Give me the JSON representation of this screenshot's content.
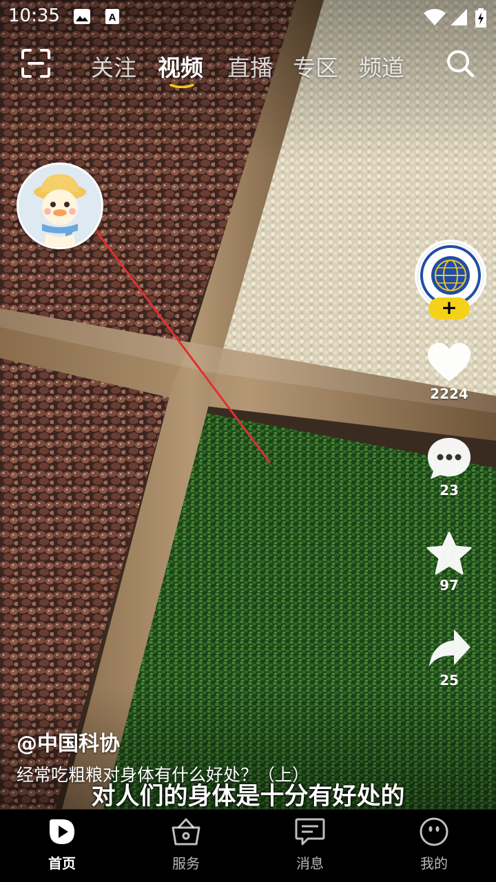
{
  "status_bar": {
    "time": "10:35",
    "left_icons": [
      "image-notification-icon",
      "font-notification-icon"
    ],
    "right_icons": [
      "wifi-icon",
      "signal-icon",
      "battery-charging-icon"
    ]
  },
  "top_nav": {
    "tabs": [
      {
        "label": "关注",
        "active": false
      },
      {
        "label": "视频",
        "active": true
      },
      {
        "label": "直播",
        "active": false
      },
      {
        "label": "专区",
        "active": false
      },
      {
        "label": "频道",
        "active": false
      }
    ],
    "accent_color": "#f5c518"
  },
  "right_rail": {
    "follow_label": "+",
    "like_count": "2224",
    "comment_count": "23",
    "favorite_count": "97",
    "share_count": "25"
  },
  "video": {
    "author": "@中国科协",
    "title": "经常吃粗粮对身体有什么好处？（上）",
    "subtitle": "对人们的身体是十分有好处的"
  },
  "bottom_nav": {
    "items": [
      {
        "label": "首页",
        "icon": "home-play-icon",
        "active": true
      },
      {
        "label": "服务",
        "icon": "service-basket-icon",
        "active": false
      },
      {
        "label": "消息",
        "icon": "message-icon",
        "active": false
      },
      {
        "label": "我的",
        "icon": "profile-icon",
        "active": false
      }
    ]
  }
}
